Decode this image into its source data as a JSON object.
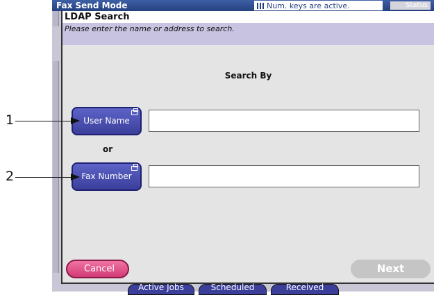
{
  "titlebar": {
    "mode": "Fax Send Mode",
    "numkeys": "Num. keys are active.",
    "status": "Status"
  },
  "dialog": {
    "title": "LDAP Search",
    "subtitle": "Please enter the name or address to search.",
    "search_by": "Search By",
    "user_name_button": "User Name",
    "or_label": "or",
    "fax_number_button": "Fax Number",
    "user_name_value": "",
    "fax_number_value": "",
    "cancel_label": "Cancel",
    "next_label": "Next"
  },
  "bottom_tabs": [
    "Active Jobs",
    "Scheduled",
    "Received"
  ],
  "callouts": [
    "1",
    "2"
  ]
}
